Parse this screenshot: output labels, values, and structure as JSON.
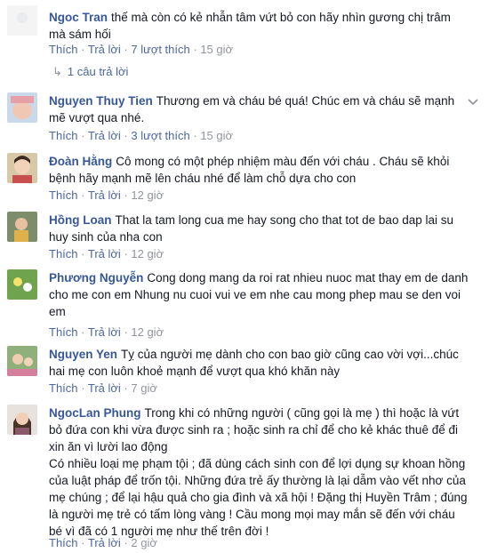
{
  "comments": [
    {
      "author": "Ngoc Tran",
      "text": "thế mà còn có kẻ nhẫn tâm vứt bỏ con hãy nhìn gương chị trâm mà sám hối",
      "like_label": "Thích",
      "reply_label": "Trả lời",
      "likes": "7 lượt thích",
      "time": "15 giờ",
      "replies": "1 câu trả lời"
    },
    {
      "author": "Nguyen Thuy Tien",
      "text": "Thương em và cháu bé quá! Chúc em và cháu sẽ mạnh mẽ vượt qua nhé.",
      "like_label": "Thích",
      "reply_label": "Trả lời",
      "likes": "3 lượt thích",
      "time": "15 giờ"
    },
    {
      "author": "Đoàn Hằng",
      "text": "Cô mong có một phép nhiệm màu đến với cháu . Cháu sẽ khỏi bệnh hãy mạnh mẽ lên cháu nhé để làm chỗ dựa cho con",
      "like_label": "Thích",
      "reply_label": "Trả lời",
      "time": "12 giờ"
    },
    {
      "author": "Hồng Loan",
      "text": "That la tam long cua me hay song cho that tot de bao dap lai su huy sinh của nha con",
      "like_label": "Thích",
      "reply_label": "Trả lời",
      "time": "12 giờ"
    },
    {
      "author": "Phương Nguyễn",
      "text": "Cong dong mang da roi rat nhieu nuoc mat thay em de danh cho me con em Nhung nu cuoi vui ve em nhe cau mong phep mau se den voi em",
      "like_label": "Thích",
      "reply_label": "Trả lời",
      "time": "12 giờ"
    },
    {
      "author": "Nguyen Yen",
      "text": "Tỵ của người mẹ dành cho con bao giờ cũng cao vời vợi...chúc hai mẹ con luôn khoẻ mạnh để vượt qua khó khăn này",
      "like_label": "Thích",
      "reply_label": "Trả lời",
      "time": "7 giờ"
    },
    {
      "author": "NgocLan Phung",
      "text": "Trong khi có những người ( cũng gọi là mẹ ) thì hoặc là vứt bỏ đứa con khi vừa được sinh ra ; hoặc sinh ra chỉ để cho kẻ khác thuê để đi xin ăn vì lười lao động",
      "text2": "Có nhiều loại mẹ phạm tội ; đã dùng cách sinh con để lợi dụng sự khoan hồng của luật pháp để trốn tội. Những đứa trẻ ấy thường là lại dẫm vào vết nhơ của mẹ chúng ; để lại hậu quả cho gia đình và xã hội ! Đặng thị Huyền Trâm ; đúng là người mẹ trẻ có tấm lòng vàng ! Cầu mong mọi may mắn sẽ đến với cháu bé vì đã có 1 người mẹ như thế trên đời !",
      "like_label": "Thích",
      "reply_label": "Trả lời",
      "time": "2 giờ"
    }
  ],
  "colors": {
    "author": "#365899",
    "link": "#4b67a1",
    "meta": "#90949c",
    "text": "#141823"
  }
}
